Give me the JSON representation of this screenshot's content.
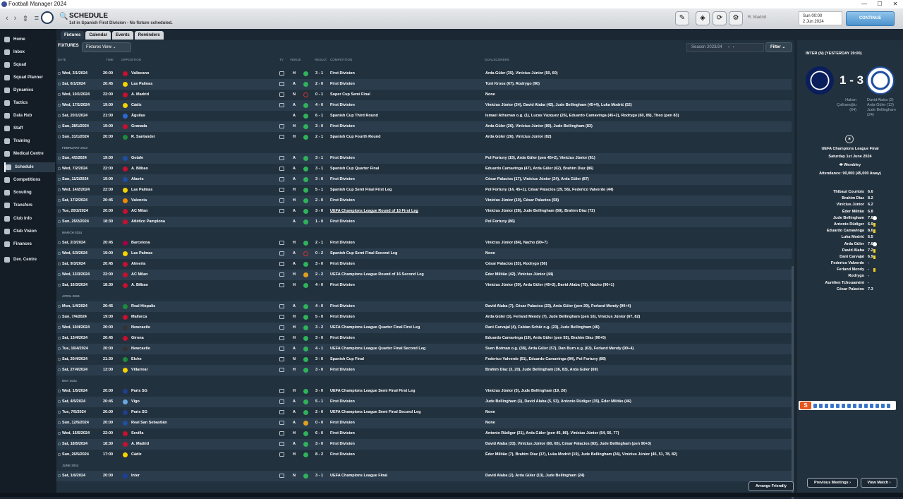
{
  "window": {
    "title": "Football Manager 2024"
  },
  "header": {
    "title": "SCHEDULE",
    "subtitle": "1st in Spanish First Division - No fixture scheduled.",
    "club_select": "R. Madrid",
    "date_line1": "Sun 00:00",
    "date_line2": "2 Jun 2024",
    "continue": "CONTINUE"
  },
  "sidebar": {
    "items": [
      {
        "label": "Home"
      },
      {
        "label": "Inbox"
      },
      {
        "label": "Squad"
      },
      {
        "label": "Squad Planner"
      },
      {
        "label": "Dynamics"
      },
      {
        "label": "Tactics"
      },
      {
        "label": "Data Hub"
      },
      {
        "label": "Staff"
      },
      {
        "label": "Training"
      },
      {
        "label": "Medical Centre"
      },
      {
        "label": "Schedule"
      },
      {
        "label": "Competitions"
      },
      {
        "label": "Scouting"
      },
      {
        "label": "Transfers"
      },
      {
        "label": "Club Info"
      },
      {
        "label": "Club Vision"
      },
      {
        "label": "Finances"
      },
      {
        "label": "Dev. Centre"
      }
    ]
  },
  "tabs": [
    "Fixtures",
    "Calendar",
    "Events",
    "Reminders"
  ],
  "toolbar": {
    "label": "FIXTURES",
    "view": "Fixtures View",
    "season": "Season 2023/24",
    "filter": "Filter"
  },
  "columns": {
    "date": "DATE",
    "time": "TIME",
    "opposition": "OPPOSITION",
    "tv": "TV",
    "venue": "VENUE",
    "result": "RESULT",
    "competition": "COMPETITION",
    "goalscorers": "GOALSCORERS"
  },
  "fixtures": [
    {
      "date": "Wed, 3/1/2024",
      "time": "20:00",
      "opp": "Vallecano",
      "tv": true,
      "venue": "H",
      "res": "3 - 1",
      "comp": "First Division",
      "scorers": "Arda Güler (35), Vinícius Júnior (50, 60)",
      "oc": "#c8102e",
      "rc": "#2fb35a"
    },
    {
      "date": "Sat, 6/1/2024",
      "time": "20:45",
      "opp": "Las Palmas",
      "tv": true,
      "venue": "A",
      "res": "2 - 0",
      "comp": "First Division",
      "scorers": "Toni Kroos (67), Rodrygo (90)",
      "oc": "#f5d300",
      "rc": "#2fb35a"
    },
    {
      "date": "Wed, 10/1/2024",
      "time": "22:00",
      "opp": "A. Madrid",
      "tv": true,
      "venue": "N",
      "res": "0 - 1",
      "comp": "Super Cup Semi Final",
      "scorers": "None",
      "oc": "#c8102e",
      "rc": "#d03030"
    },
    {
      "date": "Wed, 17/1/2024",
      "time": "19:00",
      "opp": "Cádiz",
      "tv": true,
      "venue": "A",
      "res": "4 - 0",
      "comp": "First Division",
      "scorers": "Vinícius Júnior (24), David Alaba (42), Jude Bellingham (45+4), Luka Modrić (52)",
      "oc": "#f5d300",
      "rc": "#2fb35a"
    },
    {
      "date": "Sat, 20/1/2024",
      "time": "21:00",
      "opp": "Águilas",
      "tv": false,
      "venue": "A",
      "res": "6 - 1",
      "comp": "Spanish Cup Third Round",
      "scorers": "Ismael Athuman o.g. (1), Lucas Vázquez (26), Eduardo Camavinga (45+2), Rodrygo (60, 89), Theo (pen 83)",
      "oc": "#2a6ad0",
      "rc": "#2fb35a"
    },
    {
      "date": "Sun, 28/1/2024",
      "time": "19:00",
      "opp": "Granada",
      "tv": true,
      "venue": "H",
      "res": "3 - 0",
      "comp": "First Division",
      "scorers": "Arda Güler (26), Vinícius Júnior (80), Jude Bellingham (83)",
      "oc": "#c8102e",
      "rc": "#2fb35a"
    },
    {
      "date": "Sun, 31/1/2024",
      "time": "20:00",
      "opp": "R. Santander",
      "tv": true,
      "venue": "H",
      "res": "2 - 1",
      "comp": "Spanish Cup Fourth Round",
      "scorers": "Arda Güler (26), Vinícius Júnior (82)",
      "oc": "#1e8a3c",
      "rc": "#2fb35a"
    },
    {
      "month": "FEBRUARY 2024"
    },
    {
      "date": "Sun, 4/2/2024",
      "time": "19:00",
      "opp": "Getafe",
      "tv": true,
      "venue": "A",
      "res": "3 - 1",
      "comp": "First Division",
      "scorers": "Pol Fortuny (15), Arda Güler (pen 45+2), Vinícius Júnior (61)",
      "oc": "#1f4fa0",
      "rc": "#2fb35a"
    },
    {
      "date": "Wed, 7/2/2024",
      "time": "22:00",
      "opp": "A. Bilbao",
      "tv": true,
      "venue": "A",
      "res": "3 - 1",
      "comp": "Spanish Cup Quarter Final",
      "scorers": "Eduardo Camavinga (47), Arda Güler (62), Brahim Díaz (86)",
      "oc": "#c8102e",
      "rc": "#2fb35a"
    },
    {
      "date": "Sun, 11/2/2024",
      "time": "19:00",
      "opp": "Alavés",
      "tv": true,
      "venue": "A",
      "res": "3 - 0",
      "comp": "First Division",
      "scorers": "César Palacios (17), Vinícius Júnior (24), Arda Güler (87)",
      "oc": "#1f4fa0",
      "rc": "#2fb35a"
    },
    {
      "date": "Wed, 14/2/2024",
      "time": "22:00",
      "opp": "Las Palmas",
      "tv": true,
      "venue": "H",
      "res": "5 - 1",
      "comp": "Spanish Cup Semi Final First Leg",
      "scorers": "Pol Fortuny (14, 45+1), César Palacios (29, 56), Federico Valverde (44)",
      "oc": "#f5d300",
      "rc": "#2fb35a"
    },
    {
      "date": "Sat, 17/2/2024",
      "time": "20:45",
      "opp": "Valencia",
      "tv": true,
      "venue": "H",
      "res": "2 - 0",
      "comp": "First Division",
      "scorers": "Vinícius Júnior (10), César Palacios (58)",
      "oc": "#f08a00",
      "rc": "#2fb35a"
    },
    {
      "date": "Tue, 20/2/2024",
      "time": "20:00",
      "opp": "AC Milan",
      "tv": true,
      "venue": "A",
      "res": "3 - 0",
      "comp": "UEFA Champions League Round of 16  First Leg",
      "scorers": "Vinícius Júnior (28), Jude Bellingham (68), Brahim Díaz (72)",
      "oc": "#c8102e",
      "rc": "#2fb35a",
      "underline": true
    },
    {
      "date": "Sun, 25/2/2024",
      "time": "18:30",
      "opp": "Atlético Pamplona",
      "tv": false,
      "venue": "A",
      "res": "1 - 0",
      "comp": "First Division",
      "scorers": "Pol Fortuny (86)",
      "oc": "#c8102e",
      "rc": "#2fb35a"
    },
    {
      "month": "MARCH 2024"
    },
    {
      "date": "Sat, 2/3/2024",
      "time": "20:45",
      "opp": "Barcelona",
      "tv": true,
      "venue": "H",
      "res": "2 - 1",
      "comp": "First Division",
      "scorers": "Vinícius Júnior (84), Nacho (90+7)",
      "oc": "#a50044",
      "rc": "#2fb35a"
    },
    {
      "date": "Wed, 6/3/2024",
      "time": "19:00",
      "opp": "Las Palmas",
      "tv": true,
      "venue": "A",
      "res": "0 - 2",
      "comp": "Spanish Cup Semi Final Second Leg",
      "scorers": "None",
      "oc": "#f5d300",
      "rc": "#d03030"
    },
    {
      "date": "Sat, 9/3/2024",
      "time": "20:45",
      "opp": "Almería",
      "tv": true,
      "venue": "A",
      "res": "3 - 0",
      "comp": "First Division",
      "scorers": "César Palacios (33), Rodrygo (56)",
      "oc": "#c8102e",
      "rc": "#2fb35a"
    },
    {
      "date": "Wed, 13/3/2024",
      "time": "22:00",
      "opp": "AC Milan",
      "tv": true,
      "venue": "H",
      "res": "2 - 2",
      "comp": "UEFA Champions League Round of 16  Second Leg",
      "scorers": "Éder Militão (42), Vinícius Júnior (44)",
      "oc": "#c8102e",
      "rc": "#e0a020"
    },
    {
      "date": "Sat, 16/3/2024",
      "time": "18:30",
      "opp": "A. Bilbao",
      "tv": true,
      "venue": "H",
      "res": "4 - 0",
      "comp": "First Division",
      "scorers": "Vinícius Júnior (30), Arda Güler (45+2), David Alaba (75), Nacho (90+1)",
      "oc": "#c8102e",
      "rc": "#2fb35a"
    },
    {
      "month": "APRIL 2024"
    },
    {
      "date": "Mon, 1/4/2024",
      "time": "20:45",
      "opp": "Real Hispalis",
      "tv": true,
      "venue": "A",
      "res": "4 - 0",
      "comp": "First Division",
      "scorers": "David Alaba (7), César Palacios (23), Arda Güler (pen 29), Ferland Mendy (90+4)",
      "oc": "#1e8a3c",
      "rc": "#2fb35a"
    },
    {
      "date": "Sun, 7/4/2024",
      "time": "19:00",
      "opp": "Mallorca",
      "tv": true,
      "venue": "H",
      "res": "5 - 0",
      "comp": "First Division",
      "scorers": "Arda Güler (3), Ferland Mendy (7), Jude Bellingham (pen 16), Vinícius Júnior (67, 82)",
      "oc": "#c8102e",
      "rc": "#2fb35a"
    },
    {
      "date": "Wed, 10/4/2024",
      "time": "20:00",
      "opp": "Newcastle",
      "tv": true,
      "venue": "H",
      "res": "3 - 2",
      "comp": "UEFA Champions League Quarter Final First Leg",
      "scorers": "Dani Carvajal (4), Fabian Schär o.g. (23), Jude Bellingham (46)",
      "oc": "#333333",
      "rc": "#2fb35a",
      "muted": "Fabian Schär o.g. (23),"
    },
    {
      "date": "Sat, 13/4/2024",
      "time": "20:45",
      "opp": "Girona",
      "tv": true,
      "venue": "H",
      "res": "3 - 0",
      "comp": "First Division",
      "scorers": "Eduardo Camavinga (19), Arda Güler (pen 55), Brahim Díaz (90+5)",
      "oc": "#c8102e",
      "rc": "#2fb35a"
    },
    {
      "date": "Tue, 16/4/2024",
      "time": "20:00",
      "opp": "Newcastle",
      "tv": true,
      "venue": "A",
      "res": "4 - 1",
      "comp": "UEFA Champions League Quarter Final Second Leg",
      "scorers": "Sven Botman o.g. (38), Arda Güler (57), Dan Burn o.g. (63), Ferland Mendy (90+4)",
      "oc": "#333333",
      "rc": "#2fb35a"
    },
    {
      "date": "Sat, 20/4/2024",
      "time": "21:30",
      "opp": "Elche",
      "tv": true,
      "venue": "N",
      "res": "3 - 0",
      "comp": "Spanish Cup Final",
      "scorers": "Federico Valverde (51), Eduardo Camavinga (84), Pol Fortuny (88)",
      "oc": "#1e8a3c",
      "rc": "#2fb35a"
    },
    {
      "date": "Sat, 27/4/2024",
      "time": "13:00",
      "opp": "Villarreal",
      "tv": true,
      "venue": "H",
      "res": "3 - 0",
      "comp": "First Division",
      "scorers": "Brahim Díaz (3, 20), Jude Bellingham (36, 83), Arda Güler (69)",
      "oc": "#f5d300",
      "rc": "#2fb35a"
    },
    {
      "month": "MAY 2024"
    },
    {
      "date": "Wed, 1/5/2024",
      "time": "20:00",
      "opp": "Paris SG",
      "tv": true,
      "venue": "H",
      "res": "3 - 0",
      "comp": "UEFA Champions League Semi Final First Leg",
      "scorers": "Vinícius Júnior (3), Jude Bellingham (19, 26)",
      "oc": "#1f3f8a",
      "rc": "#2fb35a"
    },
    {
      "date": "Sat, 4/5/2024",
      "time": "20:45",
      "opp": "Vigo",
      "tv": true,
      "venue": "A",
      "res": "5 - 1",
      "comp": "First Division",
      "scorers": "Jude Bellingham (1), David Alaba (5, 53), Antonio Rüdiger (35), Éder Militão (46)",
      "oc": "#6aa9e0",
      "rc": "#2fb35a"
    },
    {
      "date": "Tue, 7/5/2024",
      "time": "20:00",
      "opp": "Paris SG",
      "tv": true,
      "venue": "A",
      "res": "2 - 0",
      "comp": "UEFA Champions League Semi Final Second Leg",
      "scorers": "None",
      "oc": "#1f3f8a",
      "rc": "#2fb35a"
    },
    {
      "date": "Sun, 12/5/2024",
      "time": "20:00",
      "opp": "Real San Sebastián",
      "tv": true,
      "venue": "A",
      "res": "0 - 0",
      "comp": "First Division",
      "scorers": "None",
      "oc": "#1f4fa0",
      "rc": "#e0a020"
    },
    {
      "date": "Wed, 15/5/2024",
      "time": "22:00",
      "opp": "Sevilla",
      "tv": true,
      "venue": "H",
      "res": "6 - 0",
      "comp": "First Division",
      "scorers": "Antonio Rüdiger (21), Arda Güler (pen 45, 86), Vinícius Júnior (54, 56, 77)",
      "oc": "#c8102e",
      "rc": "#2fb35a"
    },
    {
      "date": "Sat, 18/5/2024",
      "time": "18:30",
      "opp": "A. Madrid",
      "tv": true,
      "venue": "A",
      "res": "3 - 0",
      "comp": "First Division",
      "scorers": "David Alaba (33), Vinícius Júnior (60, 65), César Palacios (83), Jude Bellingham (pen 90+3)",
      "oc": "#c8102e",
      "rc": "#2fb35a"
    },
    {
      "date": "Sun, 26/5/2024",
      "time": "17:00",
      "opp": "Cádiz",
      "tv": true,
      "venue": "H",
      "res": "8 - 2",
      "comp": "First Division",
      "scorers": "Éder Militão (7), Brahim Díaz (17), Luka Modrić (19), Jude Bellingham (34), Vinícius Júnior (45, 51, 78, 82)",
      "oc": "#f5d300",
      "rc": "#2fb35a"
    },
    {
      "month": "JUNE 2024"
    },
    {
      "date": "Sat, 1/6/2024",
      "time": "20:00",
      "opp": "Inter",
      "tv": true,
      "venue": "N",
      "res": "3 - 1",
      "comp": "UEFA Champions League Final",
      "scorers": "David Alaba (2), Arda Güler (13), Jude Bellingham (24)",
      "oc": "#1a3f9c",
      "rc": "#2fb35a"
    }
  ],
  "right_panel": {
    "title": "INTER (N) (YESTERDAY 20:00)",
    "home_score": "1",
    "away_score": "3",
    "score_sep": "-",
    "home_scorers": "Hakan Çalhanoğlu (64)",
    "away_scorers": "David Alaba (2) Arda Güler (13) Jude Bellingham (24)",
    "competition": "UEFA Champions League Final",
    "date": "Saturday 1st June 2024",
    "stadium": "Wembley",
    "attendance": "Attendance: 90,000 (45,000 Away)",
    "ratings": [
      {
        "name": "Thibaut Courtois",
        "r": "6.6"
      },
      {
        "name": "Brahim Díaz",
        "r": "8.2"
      },
      {
        "name": "Vinícius Júnior",
        "r": "6.2"
      },
      {
        "name": "Éder Militão",
        "r": "6.8"
      },
      {
        "name": "Jude Bellingham",
        "r": "7.6",
        "ball": true
      },
      {
        "name": "Antonio Rüdiger",
        "r": "6.9",
        "card": true
      },
      {
        "name": "Eduardo Camavinga",
        "r": "8.6",
        "card": true
      },
      {
        "name": "Luka Modrić",
        "r": "6.5"
      },
      {
        "name": "Arda Güler",
        "r": "7.6",
        "ball": true
      },
      {
        "name": "David Alaba",
        "r": "7.2",
        "card": true
      },
      {
        "name": "Dani Carvajal",
        "r": "6.9",
        "card": true
      },
      {
        "name": "Federico Valverde",
        "r": "-"
      },
      {
        "name": "Ferland Mendy",
        "r": "-",
        "card": true
      },
      {
        "name": "Rodrygo",
        "r": "-"
      },
      {
        "name": "Aurélien Tchouaméni",
        "r": "-"
      },
      {
        "name": "César Palacios",
        "r": "7.3"
      }
    ]
  },
  "buttons": {
    "arrange_friendly": "Arrange Friendly",
    "previous_meetings": "Previous Meetings ›",
    "view_match": "View Match ›"
  },
  "colors": {
    "win": "#2fb35a",
    "loss": "#d03030",
    "draw": "#e0a020",
    "accent": "#4b92cc"
  }
}
